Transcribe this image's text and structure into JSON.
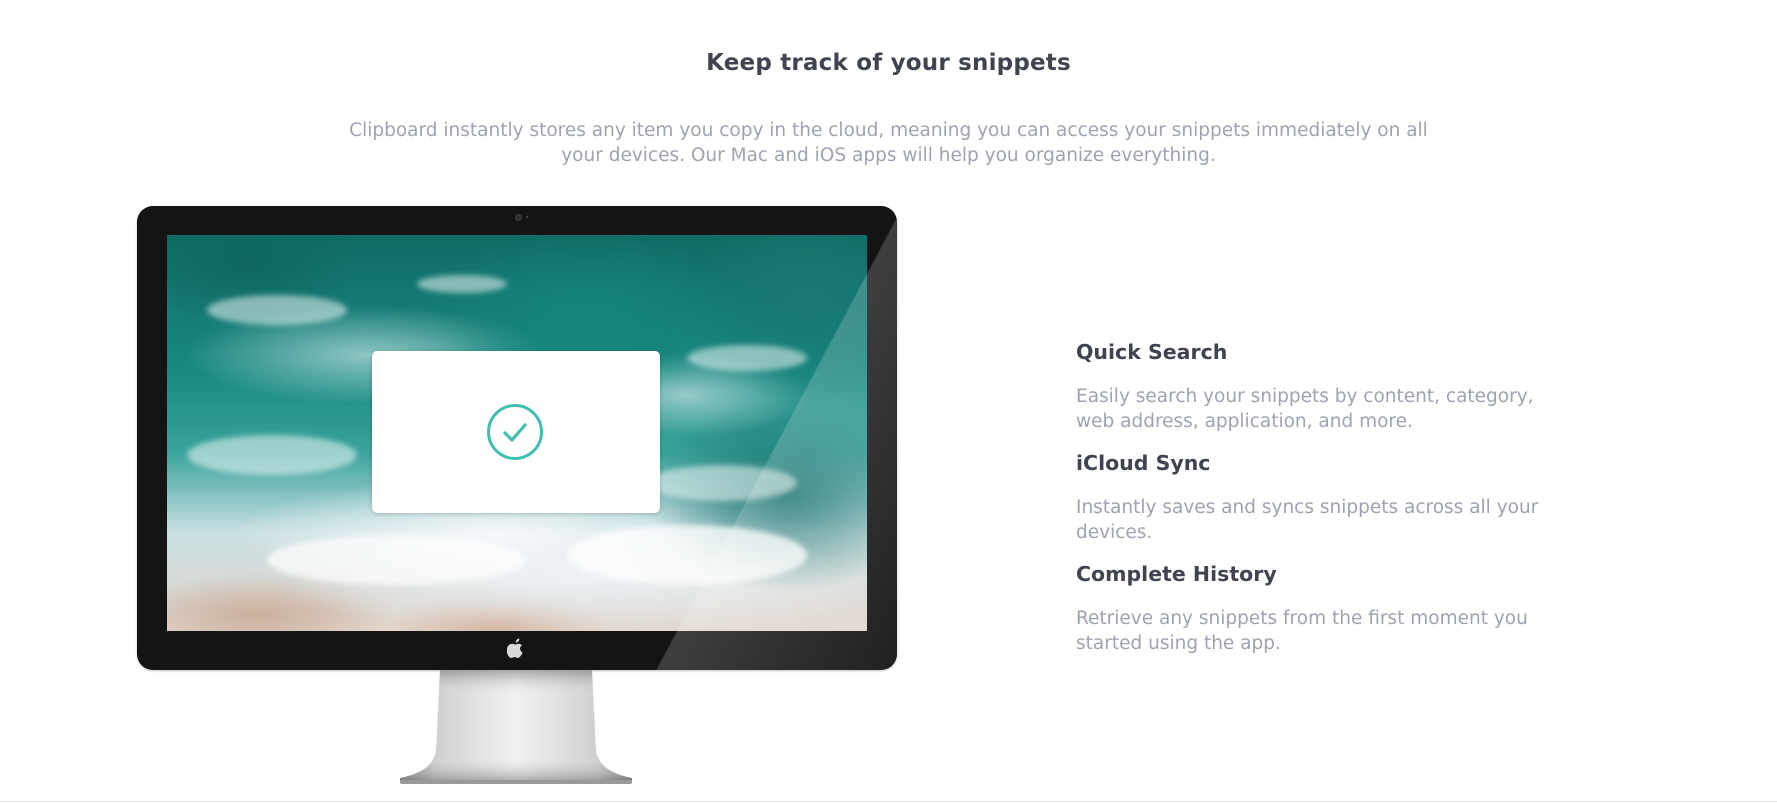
{
  "section": {
    "title": "Keep track of your snippets",
    "intro": "Clipboard instantly stores any item you copy in the cloud, meaning you can access your snippets immediately on all your devices. Our Mac and iOS apps will help you organize everything."
  },
  "illustration": {
    "screen_dialog_icon": "check-circle-icon",
    "monitor_logo_icon": "apple-icon",
    "accent_color": "#3fbfb0"
  },
  "features": [
    {
      "title": "Quick Search",
      "description": "Easily search your snippets by content, category, web address, application, and more."
    },
    {
      "title": "iCloud Sync",
      "description": "Instantly saves and syncs snippets across all your devices."
    },
    {
      "title": "Complete History",
      "description": "Retrieve any snippets from the first moment you started using the app."
    }
  ],
  "colors": {
    "heading": "#3f4450",
    "body_text": "#9da3b0",
    "background": "#ffffff"
  }
}
